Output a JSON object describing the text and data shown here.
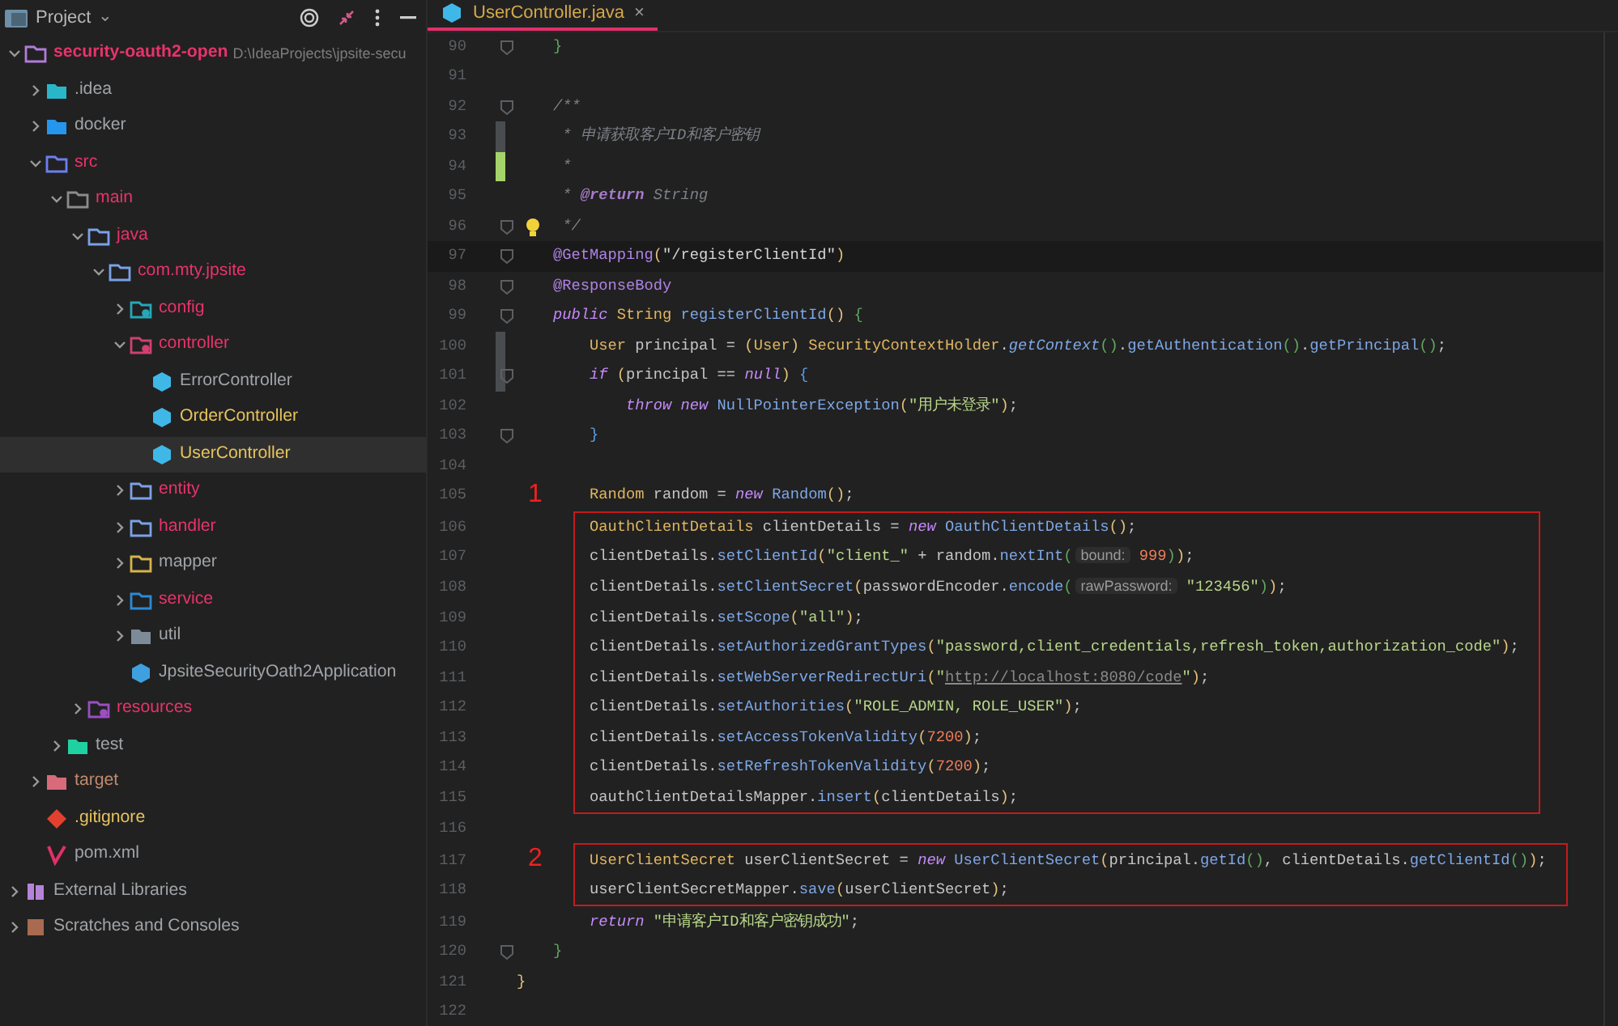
{
  "project_panel": {
    "title": "Project",
    "caret": "⌄",
    "tree": [
      {
        "label": "security-oauth2-open",
        "hint": "D:\\IdeaProjects\\jpsite-secu",
        "kind": "module",
        "color": "#e8336b",
        "expanded": true,
        "selected": false,
        "children": [
          {
            "label": ".idea",
            "kind": "idea",
            "color": "#a0a4a8",
            "expanded": false,
            "selected": false
          },
          {
            "label": "docker",
            "kind": "docker",
            "color": "#a0a4a8",
            "expanded": false,
            "selected": false
          },
          {
            "label": "src",
            "kind": "source",
            "color": "#e8336b",
            "expanded": true,
            "selected": false,
            "children": [
              {
                "label": "main",
                "kind": "plain",
                "color": "#e8336b",
                "expanded": true,
                "selected": false,
                "children": [
                  {
                    "label": "java",
                    "kind": "package",
                    "color": "#e8336b",
                    "expanded": true,
                    "selected": false,
                    "children": [
                      {
                        "label": "com.mty.jpsite",
                        "kind": "package",
                        "color": "#e8336b",
                        "expanded": true,
                        "selected": false,
                        "children": [
                          {
                            "label": "config",
                            "kind": "config",
                            "color": "#e8336b",
                            "expanded": false,
                            "selected": false
                          },
                          {
                            "label": "controller",
                            "kind": "controller",
                            "color": "#e8336b",
                            "expanded": true,
                            "selected": false,
                            "children": [
                              {
                                "label": "ErrorController",
                                "kind": "class",
                                "color": "#a0a4a8",
                                "selected": false
                              },
                              {
                                "label": "OrderController",
                                "kind": "class",
                                "color": "#e6c35c",
                                "selected": false
                              },
                              {
                                "label": "UserController",
                                "kind": "class",
                                "color": "#e6c35c",
                                "selected": true
                              }
                            ]
                          },
                          {
                            "label": "entity",
                            "kind": "package",
                            "color": "#e8336b",
                            "expanded": false,
                            "selected": false
                          },
                          {
                            "label": "handler",
                            "kind": "package",
                            "color": "#e8336b",
                            "expanded": false,
                            "selected": false
                          },
                          {
                            "label": "mapper",
                            "kind": "mapper",
                            "color": "#a0a4a8",
                            "expanded": false,
                            "selected": false
                          },
                          {
                            "label": "service",
                            "kind": "service",
                            "color": "#e8336b",
                            "expanded": false,
                            "selected": false
                          },
                          {
                            "label": "util",
                            "kind": "util",
                            "color": "#a0a4a8",
                            "expanded": false,
                            "selected": false
                          },
                          {
                            "label": "JpsiteSecurityOath2Application",
                            "kind": "app",
                            "color": "#a0a4a8",
                            "selected": false
                          }
                        ]
                      }
                    ]
                  },
                  {
                    "label": "resources",
                    "kind": "resources",
                    "color": "#e8336b",
                    "expanded": false,
                    "selected": false
                  }
                ]
              },
              {
                "label": "test",
                "kind": "test",
                "color": "#a0a4a8",
                "expanded": false,
                "selected": false
              }
            ]
          },
          {
            "label": "target",
            "kind": "excluded",
            "color": "#c08a70",
            "expanded": false,
            "selected": false
          },
          {
            "label": ".gitignore",
            "kind": "git",
            "color": "#e6c35c",
            "selected": false
          },
          {
            "label": "pom.xml",
            "kind": "maven",
            "color": "#a0a4a8",
            "selected": false
          }
        ]
      },
      {
        "label": "External Libraries",
        "kind": "library",
        "color": "#a0a4a8",
        "expanded": false,
        "selected": false
      },
      {
        "label": "Scratches and Consoles",
        "kind": "scratch",
        "color": "#a0a4a8",
        "expanded": false,
        "selected": false
      }
    ]
  },
  "tabs": [
    {
      "label": "UserController.java",
      "close": "×",
      "selected": true
    }
  ],
  "editor": {
    "segments": [
      {
        "kind": "plain",
        "lines": [
          {
            "n": "90",
            "fold": true,
            "code": [
              {
                "text": "    }",
                "kind": "inner"
              }
            ]
          },
          {
            "n": "91"
          },
          {
            "n": "92",
            "fold": true,
            "code": [
              {
                "text": "    /**",
                "kind": "comment"
              }
            ]
          },
          {
            "n": "93",
            "changed": true,
            "code": [
              {
                "text": "     * 申请获取客户ID和客户密钥",
                "kind": "comment"
              }
            ]
          },
          {
            "n": "94",
            "added": true,
            "code": [
              {
                "text": "     *",
                "kind": "comment"
              }
            ]
          },
          {
            "n": "95",
            "code": [
              {
                "text": "     *",
                "kind": "comment"
              },
              {
                "text": " @return",
                "kind": "doctag"
              },
              {
                "text": " String",
                "kind": "comment"
              }
            ]
          },
          {
            "n": "96",
            "fold": true,
            "bulb": true,
            "code": [
              {
                "text": "     */",
                "kind": "comment"
              }
            ]
          },
          {
            "n": "97",
            "fold": true,
            "current": true,
            "code": [
              {
                "text": "    @GetMapping",
                "kind": "annotation"
              },
              {
                "text": "(",
                "kind": "outer"
              },
              {
                "text": "\"/registerClientId\"",
                "kind": "selected"
              },
              {
                "text": ")",
                "kind": "outer"
              }
            ]
          },
          {
            "n": "98",
            "fold": true,
            "code": [
              {
                "text": "    @ResponseBody",
                "kind": "annotation"
              }
            ]
          },
          {
            "n": "99",
            "fold": true,
            "code": [
              {
                "text": "    public",
                "kind": "keyword"
              },
              {
                "text": " String",
                "kind": "type"
              },
              {
                "text": " registerClientId",
                "kind": "method"
              },
              {
                "text": "()",
                "kind": "outer"
              },
              {
                "text": " {",
                "kind": "inner"
              }
            ]
          },
          {
            "n": "100",
            "changed": true,
            "code": [
              {
                "text": "        User",
                "kind": "type"
              },
              {
                "text": " principal = ",
                "kind": "plain"
              },
              {
                "text": "(",
                "kind": "outer"
              },
              {
                "text": "User",
                "kind": "type"
              },
              {
                "text": ")",
                "kind": "outer"
              },
              {
                "text": " SecurityContextHolder",
                "kind": "type"
              },
              {
                "text": ".",
                "kind": "plain"
              },
              {
                "text": "getContext",
                "kind": "static"
              },
              {
                "text": "()",
                "kind": "inner"
              },
              {
                "text": ".",
                "kind": "plain"
              },
              {
                "text": "getAuthentication",
                "kind": "method"
              },
              {
                "text": "()",
                "kind": "inner"
              },
              {
                "text": ".",
                "kind": "plain"
              },
              {
                "text": "getPrincipal",
                "kind": "method"
              },
              {
                "text": "()",
                "kind": "inner"
              },
              {
                "text": ";",
                "kind": "plain"
              }
            ]
          },
          {
            "n": "101",
            "changed": true,
            "fold": true,
            "code": [
              {
                "text": "        if",
                "kind": "keyword"
              },
              {
                "text": " (",
                "kind": "outer"
              },
              {
                "text": "principal == ",
                "kind": "plain"
              },
              {
                "text": "null",
                "kind": "keyword"
              },
              {
                "text": ")",
                "kind": "outer"
              },
              {
                "text": " {",
                "kind": "block"
              }
            ]
          },
          {
            "n": "102",
            "code": [
              {
                "text": "            throw",
                "kind": "keyword"
              },
              {
                "text": " new",
                "kind": "keyword"
              },
              {
                "text": " NullPointerException",
                "kind": "method"
              },
              {
                "text": "(",
                "kind": "outer"
              },
              {
                "text": "\"用户未登录\"",
                "kind": "string"
              },
              {
                "text": ")",
                "kind": "outer"
              },
              {
                "text": ";",
                "kind": "plain"
              }
            ]
          },
          {
            "n": "103",
            "fold": true,
            "code": [
              {
                "text": "        }",
                "kind": "block"
              }
            ]
          },
          {
            "n": "104"
          },
          {
            "n": "105",
            "mark": "1",
            "code": [
              {
                "text": "        Random",
                "kind": "type"
              },
              {
                "text": " random = ",
                "kind": "plain"
              },
              {
                "text": "new",
                "kind": "keyword"
              },
              {
                "text": " Random",
                "kind": "method"
              },
              {
                "text": "()",
                "kind": "outer"
              },
              {
                "text": ";",
                "kind": "plain"
              }
            ]
          }
        ]
      },
      {
        "kind": "boxed",
        "lines": [
          {
            "n": "106",
            "code": [
              {
                "text": "        OauthClientDetails",
                "kind": "type"
              },
              {
                "text": " clientDetails = ",
                "kind": "plain"
              },
              {
                "text": "new",
                "kind": "keyword"
              },
              {
                "text": " OauthClientDetails",
                "kind": "method"
              },
              {
                "text": "()",
                "kind": "outer"
              },
              {
                "text": ";",
                "kind": "plain"
              }
            ]
          },
          {
            "n": "107",
            "code": [
              {
                "text": "        clientDetails.",
                "kind": "plain"
              },
              {
                "text": "setClientId",
                "kind": "method"
              },
              {
                "text": "(",
                "kind": "outer"
              },
              {
                "text": "\"client_\"",
                "kind": "string"
              },
              {
                "text": " + random.",
                "kind": "plain"
              },
              {
                "text": "nextInt",
                "kind": "method"
              },
              {
                "text": "(",
                "kind": "inner"
              },
              {
                "text": "bound:",
                "kind": "hint"
              },
              {
                "text": " 999",
                "kind": "number"
              },
              {
                "text": ")",
                "kind": "inner"
              },
              {
                "text": ")",
                "kind": "outer"
              },
              {
                "text": ";",
                "kind": "plain"
              }
            ]
          },
          {
            "n": "108",
            "code": [
              {
                "text": "        clientDetails.",
                "kind": "plain"
              },
              {
                "text": "setClientSecret",
                "kind": "method"
              },
              {
                "text": "(",
                "kind": "outer"
              },
              {
                "text": "passwordEncoder.",
                "kind": "plain"
              },
              {
                "text": "encode",
                "kind": "method"
              },
              {
                "text": "(",
                "kind": "inner"
              },
              {
                "text": "rawPassword:",
                "kind": "hint"
              },
              {
                "text": " \"123456\"",
                "kind": "string"
              },
              {
                "text": ")",
                "kind": "inner"
              },
              {
                "text": ")",
                "kind": "outer"
              },
              {
                "text": ";",
                "kind": "plain"
              }
            ]
          },
          {
            "n": "109",
            "code": [
              {
                "text": "        clientDetails.",
                "kind": "plain"
              },
              {
                "text": "setScope",
                "kind": "method"
              },
              {
                "text": "(",
                "kind": "outer"
              },
              {
                "text": "\"all\"",
                "kind": "string"
              },
              {
                "text": ")",
                "kind": "outer"
              },
              {
                "text": ";",
                "kind": "plain"
              }
            ]
          },
          {
            "n": "110",
            "code": [
              {
                "text": "        clientDetails.",
                "kind": "plain"
              },
              {
                "text": "setAuthorizedGrantTypes",
                "kind": "method"
              },
              {
                "text": "(",
                "kind": "outer"
              },
              {
                "text": "\"password,client_credentials,refresh_token,authorization_code\"",
                "kind": "string"
              },
              {
                "text": ")",
                "kind": "outer"
              },
              {
                "text": ";",
                "kind": "plain"
              }
            ]
          },
          {
            "n": "111",
            "code": [
              {
                "text": "        clientDetails.",
                "kind": "plain"
              },
              {
                "text": "setWebServerRedirectUri",
                "kind": "method"
              },
              {
                "text": "(",
                "kind": "outer"
              },
              {
                "text": "\"",
                "kind": "string"
              },
              {
                "text": "http://localhost:8080/code",
                "kind": "link"
              },
              {
                "text": "\"",
                "kind": "string"
              },
              {
                "text": ")",
                "kind": "outer"
              },
              {
                "text": ";",
                "kind": "plain"
              }
            ]
          },
          {
            "n": "112",
            "code": [
              {
                "text": "        clientDetails.",
                "kind": "plain"
              },
              {
                "text": "setAuthorities",
                "kind": "method"
              },
              {
                "text": "(",
                "kind": "outer"
              },
              {
                "text": "\"ROLE_ADMIN, ROLE_USER\"",
                "kind": "string"
              },
              {
                "text": ")",
                "kind": "outer"
              },
              {
                "text": ";",
                "kind": "plain"
              }
            ]
          },
          {
            "n": "113",
            "code": [
              {
                "text": "        clientDetails.",
                "kind": "plain"
              },
              {
                "text": "setAccessTokenValidity",
                "kind": "method"
              },
              {
                "text": "(",
                "kind": "outer"
              },
              {
                "text": "7200",
                "kind": "number"
              },
              {
                "text": ")",
                "kind": "outer"
              },
              {
                "text": ";",
                "kind": "plain"
              }
            ]
          },
          {
            "n": "114",
            "code": [
              {
                "text": "        clientDetails.",
                "kind": "plain"
              },
              {
                "text": "setRefreshTokenValidity",
                "kind": "method"
              },
              {
                "text": "(",
                "kind": "outer"
              },
              {
                "text": "7200",
                "kind": "number"
              },
              {
                "text": ")",
                "kind": "outer"
              },
              {
                "text": ";",
                "kind": "plain"
              }
            ]
          },
          {
            "n": "115",
            "code": [
              {
                "text": "        oauthClientDetailsMapper.",
                "kind": "plain"
              },
              {
                "text": "insert",
                "kind": "method"
              },
              {
                "text": "(",
                "kind": "outer"
              },
              {
                "text": "clientDetails",
                "kind": "plain"
              },
              {
                "text": ")",
                "kind": "outer"
              },
              {
                "text": ";",
                "kind": "plain"
              }
            ]
          }
        ]
      },
      {
        "kind": "plain",
        "lines": [
          {
            "n": "116"
          }
        ]
      },
      {
        "kind": "boxed",
        "lines": [
          {
            "n": "117",
            "mark": "2",
            "code": [
              {
                "text": "        UserClientSecret",
                "kind": "type"
              },
              {
                "text": " userClientSecret = ",
                "kind": "plain"
              },
              {
                "text": "new",
                "kind": "keyword"
              },
              {
                "text": " UserClientSecret",
                "kind": "method"
              },
              {
                "text": "(",
                "kind": "outer"
              },
              {
                "text": "principal.",
                "kind": "plain"
              },
              {
                "text": "getId",
                "kind": "method"
              },
              {
                "text": "()",
                "kind": "inner"
              },
              {
                "text": ", clientDetails.",
                "kind": "plain"
              },
              {
                "text": "getClientId",
                "kind": "method"
              },
              {
                "text": "()",
                "kind": "inner"
              },
              {
                "text": ")",
                "kind": "outer"
              },
              {
                "text": ";",
                "kind": "plain"
              }
            ]
          },
          {
            "n": "118",
            "code": [
              {
                "text": "        userClientSecretMapper.",
                "kind": "plain"
              },
              {
                "text": "save",
                "kind": "method"
              },
              {
                "text": "(",
                "kind": "outer"
              },
              {
                "text": "userClientSecret",
                "kind": "plain"
              },
              {
                "text": ")",
                "kind": "outer"
              },
              {
                "text": ";",
                "kind": "plain"
              }
            ]
          }
        ]
      },
      {
        "kind": "plain",
        "lines": [
          {
            "n": "119",
            "code": [
              {
                "text": "        return",
                "kind": "keyword"
              },
              {
                "text": " \"申请客户ID和客户密钥成功\"",
                "kind": "string"
              },
              {
                "text": ";",
                "kind": "plain"
              }
            ]
          },
          {
            "n": "120",
            "fold": true,
            "code": [
              {
                "text": "    }",
                "kind": "inner"
              }
            ]
          },
          {
            "n": "121",
            "code": [
              {
                "text": "}",
                "kind": "outer"
              }
            ]
          },
          {
            "n": "122"
          }
        ]
      }
    ]
  }
}
